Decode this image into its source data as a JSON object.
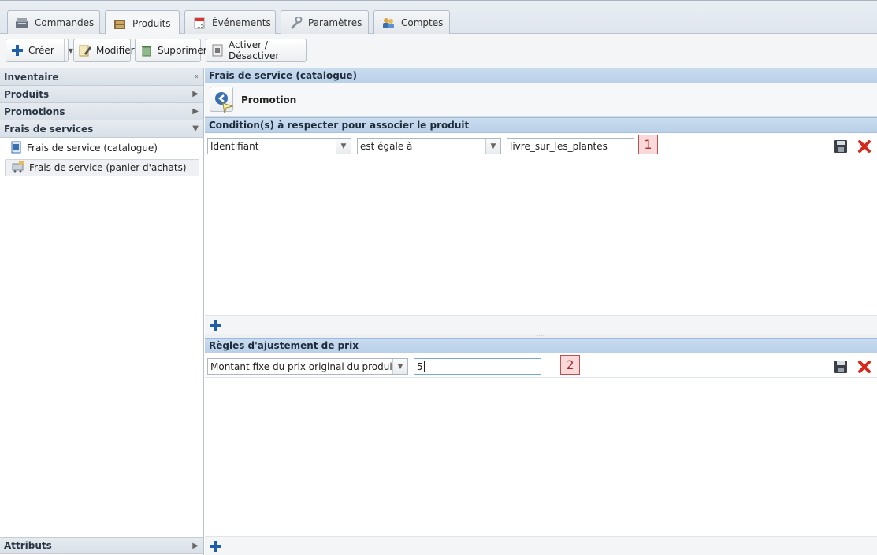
{
  "tabs": [
    {
      "label": "Commandes",
      "icon": "register-icon"
    },
    {
      "label": "Produits",
      "icon": "box-icon",
      "active": true
    },
    {
      "label": "Événements",
      "icon": "calendar-icon"
    },
    {
      "label": "Paramètres",
      "icon": "wrench-icon"
    },
    {
      "label": "Comptes",
      "icon": "users-icon"
    }
  ],
  "toolbar": {
    "create_label": "Créer",
    "edit_label": "Modifier",
    "delete_label": "Supprimer",
    "toggle_label": "Activer / Désactiver"
  },
  "sidebar": {
    "inventory": "Inventaire",
    "products": "Produits",
    "promotions": "Promotions",
    "service_fees": "Frais de services",
    "items": [
      {
        "label": "Frais de service (catalogue)"
      },
      {
        "label": "Frais de service (panier d'achats)"
      }
    ],
    "attributes": "Attributs"
  },
  "main": {
    "section_title": "Frais de service (catalogue)",
    "promotion_label": "Promotion",
    "conditions_title": "Condition(s) à respecter pour associer le produit",
    "condition_row": {
      "field": "Identifiant",
      "operator": "est égale à",
      "value": "livre_sur_les_plantes",
      "marker": "1"
    },
    "rules_title": "Règles d'ajustement de prix",
    "rule_row": {
      "type": "Montant fixe du prix original du produit",
      "value": "5",
      "marker": "2"
    }
  },
  "colors": {
    "section_header": "#c4d9ee",
    "marker_bg": "#f9d9d9",
    "marker_border": "#c0504d",
    "delete_red": "#d42a1e",
    "add_blue": "#1f5fa8"
  }
}
